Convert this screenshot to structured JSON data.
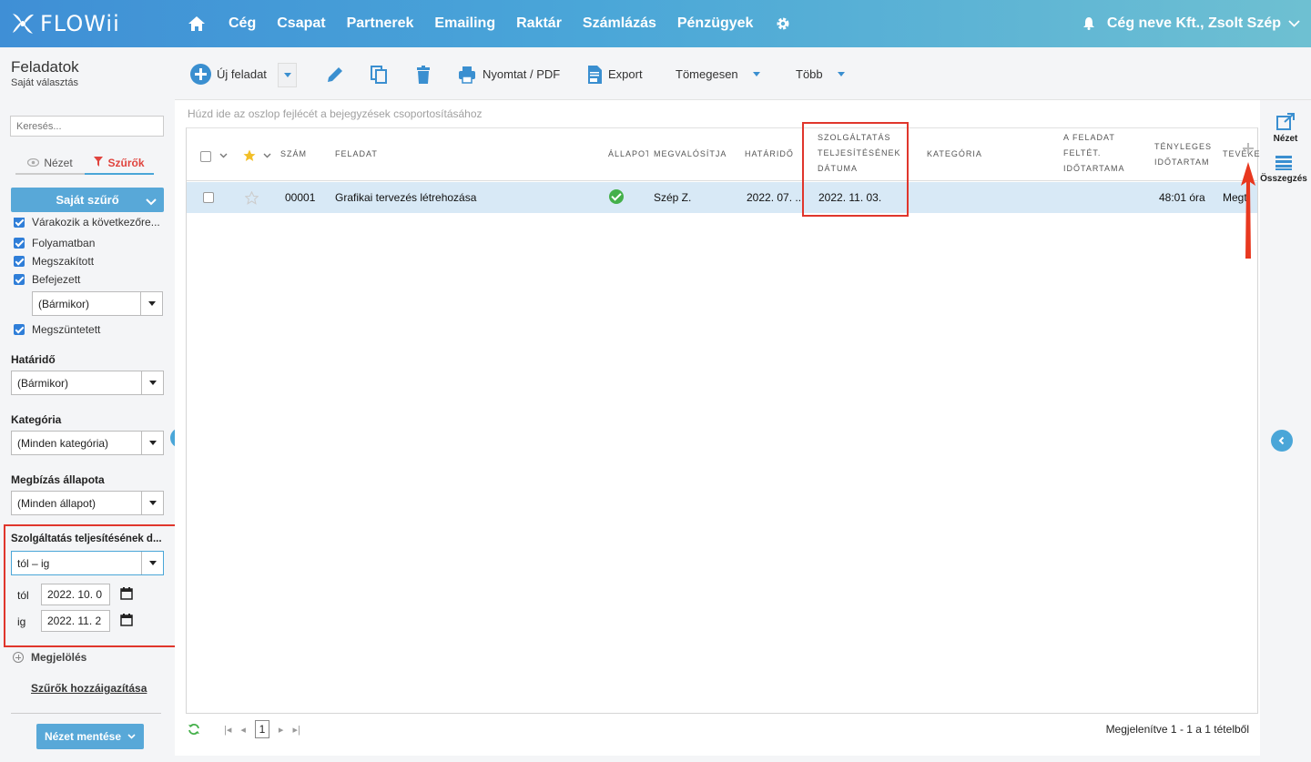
{
  "app": {
    "logo_text": "FLOWii",
    "nav": [
      "Cég",
      "Csapat",
      "Partnerek",
      "Emailing",
      "Raktár",
      "Számlázás",
      "Pénzügyek"
    ],
    "company_user": "Cég neve Kft., Zsolt Szép"
  },
  "left": {
    "title": "Feladatok",
    "subtitle": "Saját választás",
    "search_placeholder": "Keresés...",
    "tab_view": "Nézet",
    "tab_filters": "Szűrők",
    "own_filter": "Saját szűrő",
    "status_items": [
      "Várakozik a következőre...",
      "Folyamatban",
      "Megszakított",
      "Befejezett"
    ],
    "status_time": "(Bármikor)",
    "cancelled": "Megszüntetett",
    "deadline_label": "Határidő",
    "deadline_value": "(Bármikor)",
    "category_label": "Kategória",
    "category_value": "(Minden kategória)",
    "order_status_label": "Megbízás állapota",
    "order_status_value": "(Minden állapot)",
    "service_date_label": "Szolgáltatás teljesítésének d...",
    "range_value": "tól – ig",
    "from_label": "tól",
    "from_value": "2022. 10. 0",
    "to_label": "ig",
    "to_value": "2022. 11. 2",
    "marking": "Megjelölés",
    "assign_filters": "Szűrők hozzáigazítása",
    "save_view": "Nézet mentése"
  },
  "toolbar": {
    "new_task": "Új feladat",
    "print": "Nyomtat / PDF",
    "export": "Export",
    "bulk": "Tömegesen",
    "more": "Több"
  },
  "grid": {
    "group_hint": "Húzd ide az oszlop fejlécét a bejegyzések csoportosításához",
    "headers": {
      "number": "Szám",
      "task": "Feladat",
      "status": "Állapot",
      "assignee": "Megvalósítja",
      "deadline": "Határidő",
      "service_date_1": "Szolgáltatás",
      "service_date_2": "teljesítésének",
      "service_date_3": "dátuma",
      "category": "Kategória",
      "duration_1": "A feladat",
      "duration_2": "feltét.",
      "duration_3": "időtartama",
      "actual_1": "Tényleges",
      "actual_2": "időtartam",
      "activity": "Tevéke"
    },
    "row": {
      "number": "00001",
      "task": "Grafikai tervezés létrehozása",
      "assignee": "Szép Z.",
      "deadline": "2022. 07. ...",
      "service_date": "2022. 11. 03.",
      "actual": "48:01 óra",
      "activity": "Megt"
    },
    "page": "1",
    "showing": "Megjelenítve 1 - 1 a 1 tételből"
  },
  "rail": {
    "view": "Nézet",
    "summary": "Összegzés"
  },
  "colors": {
    "accent": "#4aa6d8",
    "highlight": "#e0362c",
    "row_selected": "#d8e9f6",
    "status_ok": "#44b04a"
  }
}
